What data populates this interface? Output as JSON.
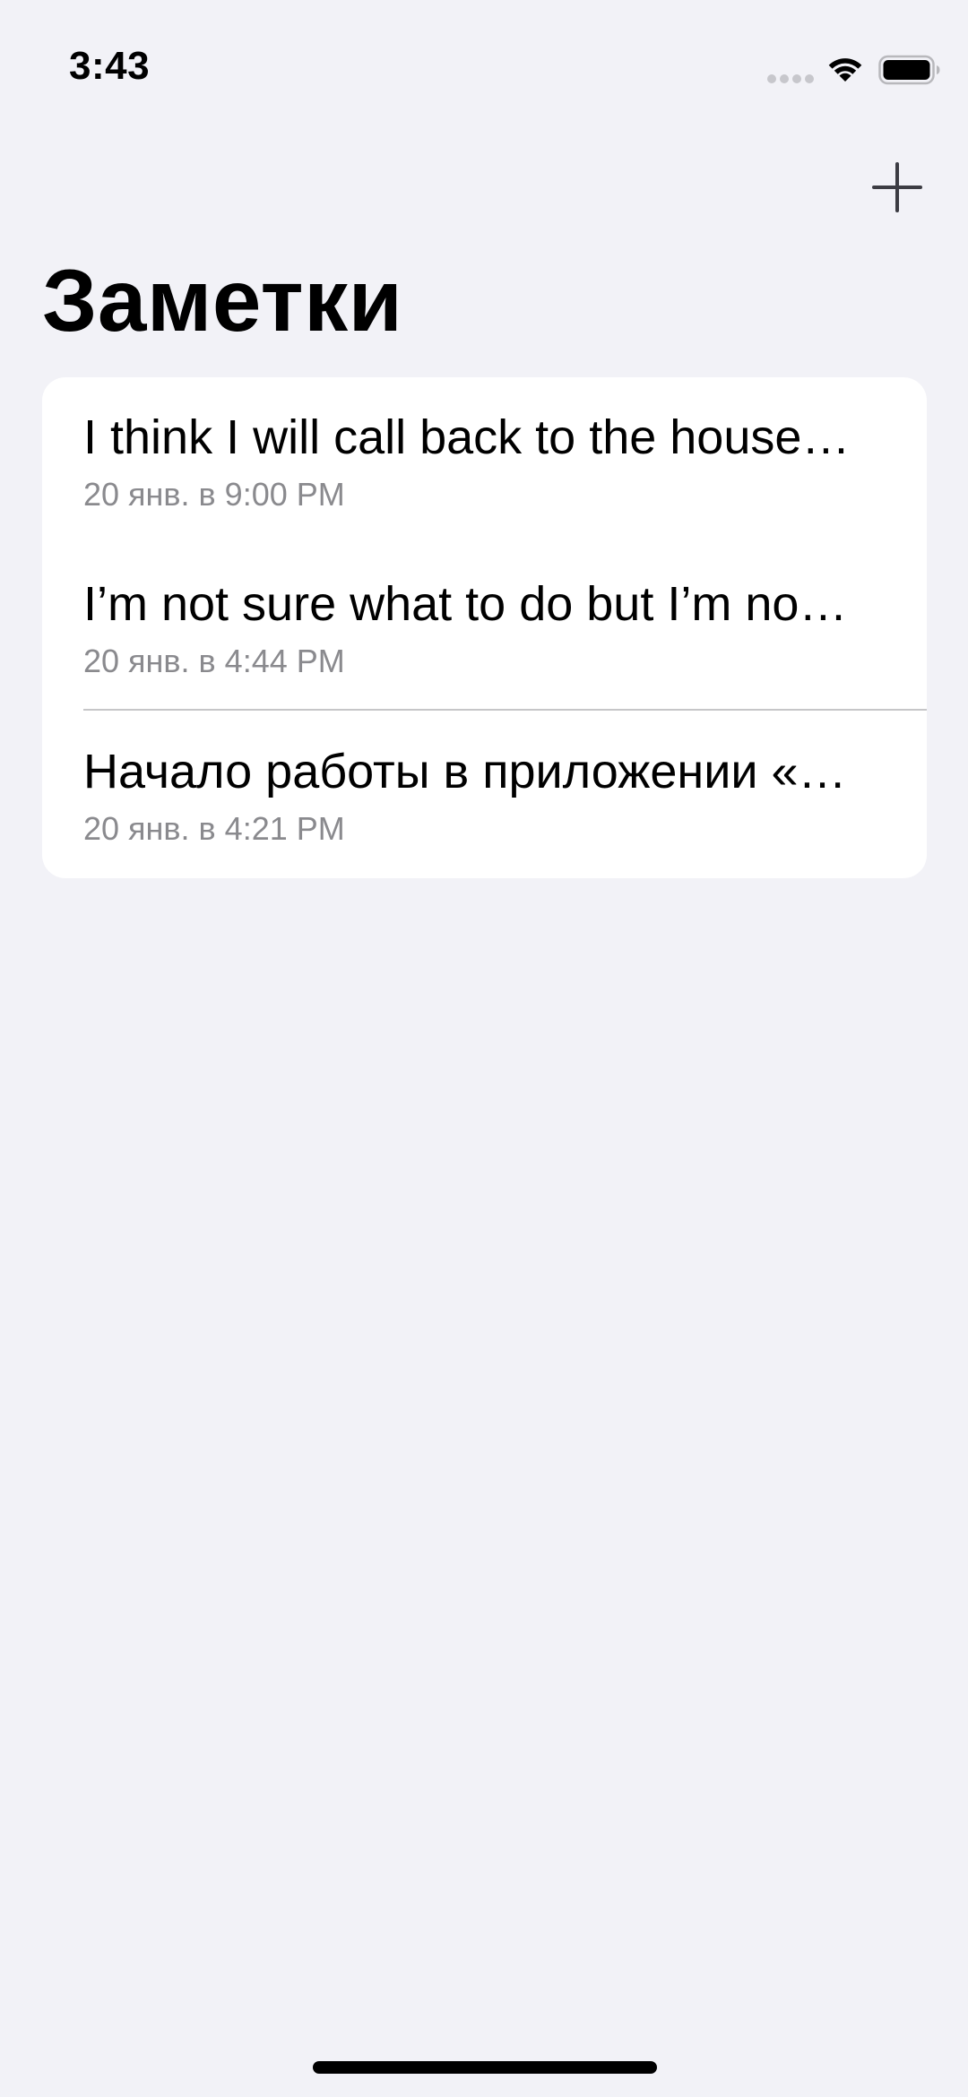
{
  "status_bar": {
    "time": "3:43"
  },
  "toolbar": {
    "add_icon": "plus-icon"
  },
  "header": {
    "title": "Заметки"
  },
  "notes": [
    {
      "title": "I think I will call back to the house…",
      "date": "20 янв. в 9:00 PM"
    },
    {
      "title": "I’m not sure what to do but I’m no…",
      "date": "20 янв. в 4:44 PM"
    },
    {
      "title": "Начало работы в приложении «…",
      "date": "20 янв. в 4:21 PM"
    }
  ],
  "colors": {
    "background": "#F2F2F7",
    "card": "#FFFFFF",
    "secondary_text": "#8A8A8E",
    "separator": "#C6C6C8"
  }
}
